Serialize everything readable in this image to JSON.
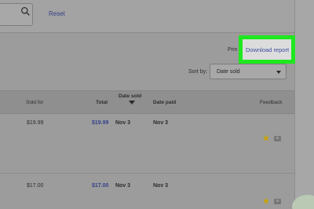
{
  "toolbar": {
    "reset_label": "Reset"
  },
  "actions": {
    "print_label": "Prin",
    "download_label": "Download report"
  },
  "sort": {
    "label": "Sort by:",
    "selected": "Date sold"
  },
  "table": {
    "headers": {
      "sold_for": "Sold for",
      "total": "Total",
      "date_sold": "Date sold",
      "date_paid": "Date paid",
      "feedback": "Feedback"
    },
    "rows": [
      {
        "sold_for": "$19.99",
        "total": "$19.99",
        "date_sold": "Nov 3",
        "date_paid": "Nov 3"
      },
      {
        "sold_for": "$17.00",
        "total": "$17.00",
        "date_sold": "Nov 3",
        "date_paid": "Nov 3"
      }
    ]
  },
  "colors": {
    "highlight": "#1ee81e",
    "link": "#34418a",
    "star": "#c9a400"
  },
  "icons": {
    "search": "search-icon",
    "sort": "chevron-down-icon",
    "feedback_star": "star-icon",
    "feedback_camera": "camera-icon"
  }
}
